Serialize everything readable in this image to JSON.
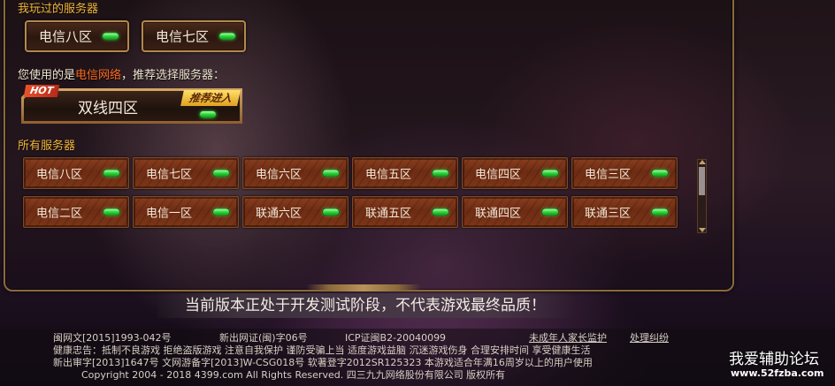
{
  "labels": {
    "played": "我玩过的服务器",
    "using_prefix": "您使用的是",
    "using_network": "电信网络",
    "using_suffix": "，推荐选择服务器：",
    "all": "所有服务器"
  },
  "played_servers": [
    {
      "name": "电信八区"
    },
    {
      "name": "电信七区"
    }
  ],
  "recommended": {
    "tag": "HOT",
    "name": "双线四区",
    "action": "推荐进入"
  },
  "all_servers": [
    {
      "name": "电信八区"
    },
    {
      "name": "电信七区"
    },
    {
      "name": "电信六区"
    },
    {
      "name": "电信五区"
    },
    {
      "name": "电信四区"
    },
    {
      "name": "电信三区"
    },
    {
      "name": "电信二区"
    },
    {
      "name": "电信一区"
    },
    {
      "name": "联通六区"
    },
    {
      "name": "联通五区"
    },
    {
      "name": "联通四区"
    },
    {
      "name": "联通三区"
    }
  ],
  "notice": "当前版本正处于开发测试阶段，不代表游戏最终品质！",
  "footer": {
    "line1_a": "闽网文[2015]1993-042号",
    "line1_b": "新出网证(闽)字06号",
    "line1_c": "ICP证闽B2-20040099",
    "link_parents": "未成年人家长监护",
    "link_dispute": "处理纠纷",
    "line2": "健康忠告：抵制不良游戏  拒绝盗版游戏  注意自我保护  谨防受骗上当  适度游戏益脑  沉迷游戏伤身  合理安排时间  享受健康生活",
    "line3": "新出审字[2013]1647号  文网游备字[2013]W-CSG018号  软著登字2012SR125323  本游戏适合年满16周岁以上的用户使用",
    "line4": "Copyright 2004 - 2018 4399.com All Rights Reserved. 四三九九网络股份有限公司 版权所有"
  },
  "watermark": {
    "title": "我爱辅助论坛",
    "url": "www.52fzba.com"
  },
  "colors": {
    "accent_gold": "#f2b63c",
    "network_highlight": "#ff6a1e",
    "status_online": "#2fd63a"
  }
}
